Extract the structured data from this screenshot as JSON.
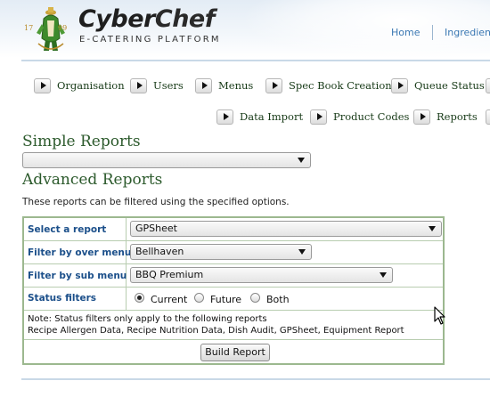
{
  "brand": {
    "name_part1": "Cyber",
    "name_part2": "Chef",
    "tagline": "E-CATERING PLATFORM",
    "crest_year_left": "17",
    "crest_year_right": "99"
  },
  "top_links": [
    "Home",
    "Ingredien"
  ],
  "nav_row1": [
    "Organisation",
    "Users",
    "Menus",
    "Spec Book Creation",
    "Queue Status"
  ],
  "nav_row2": [
    "Data Import",
    "Product Codes",
    "Reports"
  ],
  "simple_reports": {
    "heading": "Simple Reports",
    "selected": ""
  },
  "advanced_reports": {
    "heading": "Advanced Reports",
    "description": "These reports can be filtered using the specified options.",
    "filters": {
      "select_report": {
        "label": "Select a report",
        "value": "GPSheet"
      },
      "over_menu": {
        "label": "Filter by over menu",
        "value": "Bellhaven"
      },
      "sub_menu": {
        "label": "Filter by sub menu",
        "value": "BBQ Premium"
      }
    },
    "status": {
      "label": "Status filters",
      "options": [
        "Current",
        "Future",
        "Both"
      ],
      "selected": "Current"
    },
    "note_line1": "Note: Status filters only apply to the following reports",
    "note_line2": "Recipe Allergen Data, Recipe Nutrition Data, Dish Audit, GPSheet, Equipment Report",
    "build_button": "Build Report"
  },
  "colors": {
    "heading_green": "#2c5a2c",
    "label_blue": "#1b4f8a",
    "panel_border": "#9cb88f",
    "link_blue": "#3b78b3"
  }
}
